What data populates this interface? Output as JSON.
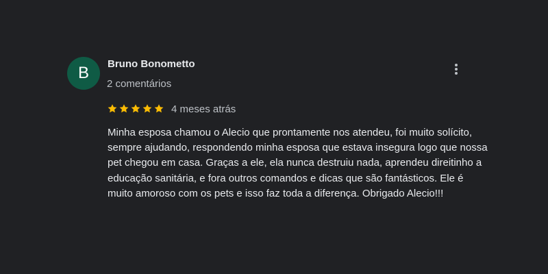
{
  "review": {
    "author": {
      "initial": "B",
      "name": "Bruno Bonometto",
      "comments_count": "2 comentários",
      "avatar_color": "#0f5b45"
    },
    "rating": {
      "stars": 5,
      "max_stars": 5,
      "star_color": "#fbbc04",
      "star_icon": "star-icon"
    },
    "date": "4 meses atrás",
    "text": "Minha esposa chamou o Alecio que prontamente nos atendeu, foi muito solícito, sempre ajudando, respondendo minha esposa que estava insegura logo que nossa pet chegou em casa. Graças a ele, ela nunca destruiu nada, aprendeu direitinho a educação sanitária, e fora outros comandos e dicas que são fantásticos. Ele é muito amoroso com os pets e isso faz toda a diferença. Obrigado Alecio!!!",
    "menu_icon": "more-vertical-icon"
  }
}
